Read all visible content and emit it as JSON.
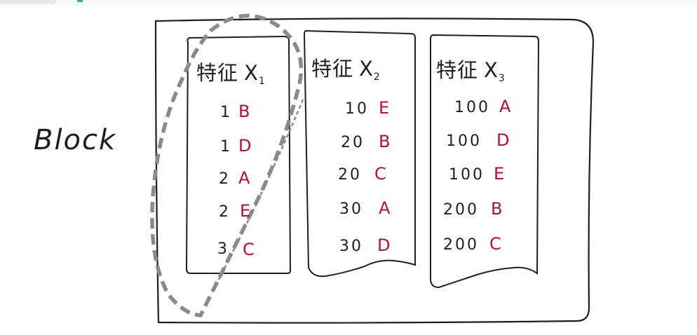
{
  "block_label": "Block",
  "columns": [
    {
      "title_prefix": "特征",
      "title_var": "X",
      "title_sub": "1",
      "rows": [
        {
          "value": "1",
          "letter": "B"
        },
        {
          "value": "1",
          "letter": "D"
        },
        {
          "value": "2",
          "letter": "A"
        },
        {
          "value": "2",
          "letter": "E"
        },
        {
          "value": "3",
          "letter": "C"
        }
      ]
    },
    {
      "title_prefix": "特征",
      "title_var": "X",
      "title_sub": "2",
      "rows": [
        {
          "value": "10",
          "letter": "E"
        },
        {
          "value": "20",
          "letter": "B"
        },
        {
          "value": "20",
          "letter": "C"
        },
        {
          "value": "30",
          "letter": "A"
        },
        {
          "value": "30",
          "letter": "D"
        }
      ]
    },
    {
      "title_prefix": "特征",
      "title_var": "X",
      "title_sub": "3",
      "rows": [
        {
          "value": "100",
          "letter": "A"
        },
        {
          "value": "100",
          "letter": "D"
        },
        {
          "value": "100",
          "letter": "E"
        },
        {
          "value": "200",
          "letter": "B"
        },
        {
          "value": "200",
          "letter": "C"
        }
      ]
    }
  ],
  "colors": {
    "ink": "#1f1f1f",
    "letter": "#b0103a",
    "dashed_outline": "#8a8a8a",
    "background": "#ffffff"
  }
}
